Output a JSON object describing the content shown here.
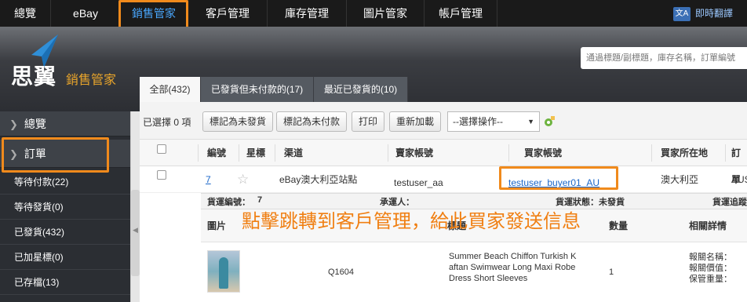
{
  "topnav": {
    "items": [
      "總覽",
      "eBay",
      "銷售管家",
      "客戶管理",
      "庫存管理",
      "圖片管家",
      "帳戶管理"
    ],
    "translate_label": "即時翻譯",
    "translate_icon": "translate-icon"
  },
  "header": {
    "logo_main": "思翼",
    "logo_sub": "銷售管家",
    "search_placeholder": "通過標題/副標題，庫存名稱，訂單編號"
  },
  "tabs": [
    {
      "label": "全部(432)",
      "active": true
    },
    {
      "label": "已發貨但未付款的(17)",
      "active": false
    },
    {
      "label": "最近已發貨的(10)",
      "active": false
    }
  ],
  "sidebar": {
    "section_overview": "總覽",
    "section_orders": "訂單",
    "items": [
      "等待付款(22)",
      "等待發貨(0)",
      "已發貨(432)",
      "已加星標(0)",
      "已存檔(13)"
    ]
  },
  "toolbar": {
    "selected_count": "已選擇 0 項",
    "mark_unshipped": "標記為未發貨",
    "mark_unpaid": "標記為未付款",
    "print": "打印",
    "reload": "重新加載",
    "select_action": "--選擇操作--"
  },
  "table": {
    "headers": [
      "編號",
      "星標",
      "渠道",
      "賣家帳號",
      "買家帳號",
      "買家所在地",
      "訂單"
    ],
    "row": {
      "id": "7",
      "channel": "eBay澳大利亞站點",
      "seller": "testuser_aa",
      "buyer": "testuser_buyer01_AU",
      "location": "澳大利亞",
      "order_partial": "AUS"
    }
  },
  "detail": {
    "bar": [
      "貨運編號：",
      "7",
      "承運人：",
      "貨運狀態：未發貨",
      "貨運追蹤"
    ],
    "headers": [
      "圖片",
      "標題",
      "數量",
      "相關詳情"
    ],
    "sku": "Q1604",
    "title": "Summer Beach Chiffon Turkish K aftan Swimwear Long Maxi Robe Dress Short Sleeves",
    "title_lines": [
      "Summer Beach Chiffon Turkish K",
      "aftan Swimwear Long Maxi Robe",
      "Dress Short Sleeves"
    ],
    "quantity": "1",
    "details": [
      "報關名稱：",
      "報關價值：",
      "保管重量："
    ]
  },
  "annotation": "點擊跳轉到客戶管理，給此買家發送信息",
  "colors": {
    "highlight": "#f08a1c",
    "nav_active": "#4aa8ff",
    "link": "#1a66c9",
    "logo_sub": "#e9a52b"
  }
}
